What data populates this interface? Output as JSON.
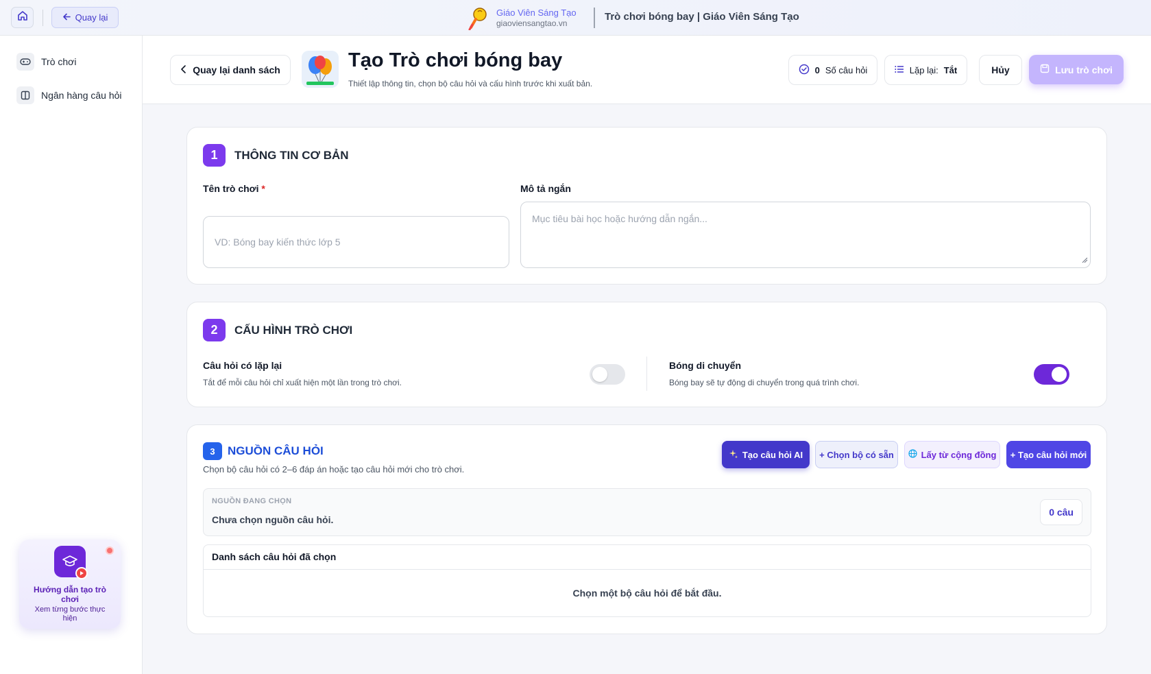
{
  "topbar": {
    "back_label": "Quay lại",
    "brand_name": "Giáo Viên Sáng Tạo",
    "brand_url": "giaoviensangtao.vn",
    "page_heading": "Trò chơi bóng bay | Giáo Viên Sáng Tạo"
  },
  "sidebar": {
    "items": [
      {
        "label": "Trò chơi",
        "icon": "gamepad-icon"
      },
      {
        "label": "Ngân hàng câu hỏi",
        "icon": "book-icon"
      }
    ],
    "guide": {
      "title": "Hướng dẫn tạo trò chơi",
      "subtitle": "Xem từng bước thực hiện"
    }
  },
  "header": {
    "back_to_list": "Quay lại danh sách",
    "title": "Tạo Trò chơi bóng bay",
    "subtitle": "Thiết lập thông tin, chọn bộ câu hỏi và cấu hình trước khi xuất bản.",
    "question_count": "0",
    "question_count_label": "Số câu hỏi",
    "repeat_label": "Lặp lại:",
    "repeat_value": "Tắt",
    "cancel_label": "Hủy",
    "save_label": "Lưu trò chơi"
  },
  "section1": {
    "number": "1",
    "title": "THÔNG TIN CƠ BẢN",
    "name_label": "Tên trò chơi",
    "name_required": "*",
    "name_placeholder": "VD: Bóng bay kiến thức lớp 5",
    "desc_label": "Mô tả ngắn",
    "desc_placeholder": "Mục tiêu bài học hoặc hướng dẫn ngắn..."
  },
  "section2": {
    "number": "2",
    "title": "CẤU HÌNH TRÒ CHƠI",
    "repeat_title": "Câu hỏi có lặp lại",
    "repeat_desc": "Tắt để mỗi câu hỏi chỉ xuất hiện một lần trong trò chơi.",
    "repeat_on": false,
    "move_title": "Bóng di chuyển",
    "move_desc": "Bóng bay sẽ tự động di chuyển trong quá trình chơi.",
    "move_on": true
  },
  "section3": {
    "number": "3",
    "title": "NGUỒN CÂU HỎI",
    "subtitle": "Chọn bộ câu hỏi có 2–6 đáp án hoặc tạo câu hỏi mới cho trò chơi.",
    "btn_ai": "Tạo câu hỏi AI",
    "btn_existing": "+ Chọn bộ có sẵn",
    "btn_community": "Lấy từ cộng đồng",
    "btn_new": "+ Tạo câu hỏi mới",
    "selected_label": "NGUỒN ĐANG CHỌN",
    "selected_value": "Chưa chọn nguồn câu hỏi.",
    "selected_count": "0 câu",
    "list_title": "Danh sách câu hỏi đã chọn",
    "list_empty": "Chọn một bộ câu hỏi để bắt đầu."
  },
  "colors": {
    "accent": "#7c3aed",
    "primary_blue": "#4338ca",
    "save_disabled": "#c4b5fd"
  }
}
